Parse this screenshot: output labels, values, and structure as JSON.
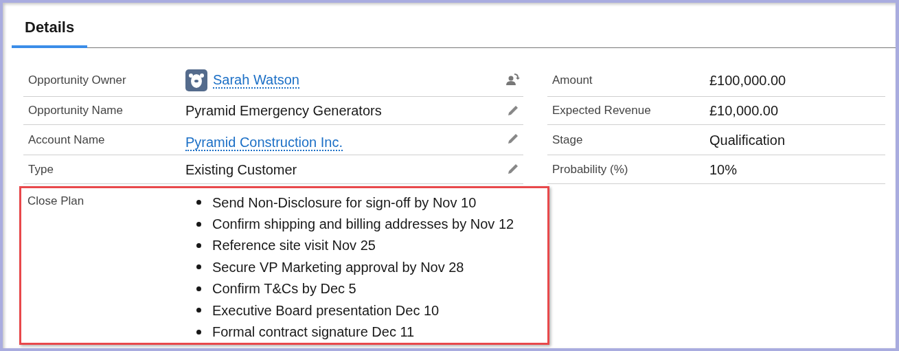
{
  "tabs": [
    {
      "label": "Details",
      "selected": true
    }
  ],
  "left_fields": [
    {
      "label": "Opportunity Owner",
      "value": "Sarah Watson",
      "kind": "user"
    },
    {
      "label": "Opportunity Name",
      "value": "Pyramid Emergency Generators",
      "kind": "text"
    },
    {
      "label": "Account Name",
      "value": "Pyramid Construction Inc.",
      "kind": "link"
    },
    {
      "label": "Type",
      "value": "Existing Customer",
      "kind": "text"
    }
  ],
  "right_fields": [
    {
      "label": "Amount",
      "value": "£100,000.00"
    },
    {
      "label": "Expected Revenue",
      "value": "£10,000.00"
    },
    {
      "label": "Stage",
      "value": "Qualification"
    },
    {
      "label": "Probability (%)",
      "value": "10%"
    }
  ],
  "close_plan": {
    "label": "Close Plan",
    "highlighted": true,
    "items": [
      "Send Non-Disclosure for sign-off by Nov 10",
      "Confirm shipping and billing addresses by Nov 12",
      "Reference site visit Nov 25",
      "Secure VP Marketing approval by Nov 28",
      "Confirm T&Cs by Dec 5",
      "Executive Board presentation Dec 10",
      "Formal contract signature Dec 11"
    ]
  }
}
